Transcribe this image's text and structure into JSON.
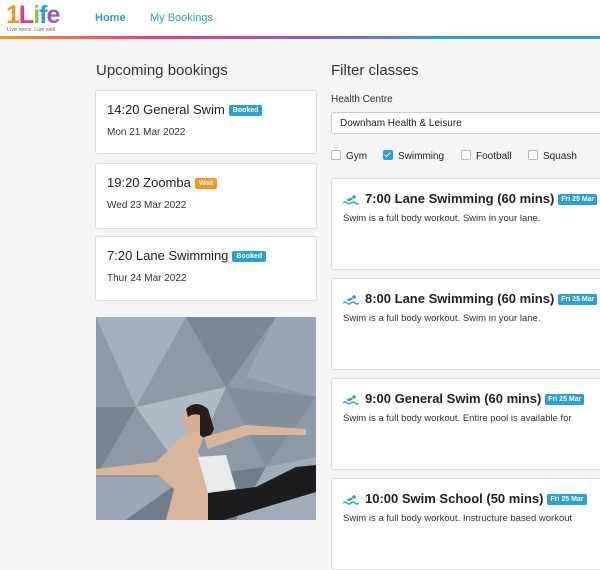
{
  "header": {
    "logo_main": "1Life",
    "logo_tagline": "Live more. Live well.",
    "nav": [
      {
        "label": "Home",
        "active": true
      },
      {
        "label": "My Bookings",
        "active": false
      }
    ]
  },
  "upcoming": {
    "heading": "Upcoming bookings",
    "bookings": [
      {
        "title": "14:20 General Swim",
        "badge": "Booked",
        "badge_color": "#2a9fd8",
        "date": "Mon 21 Mar 2022"
      },
      {
        "title": "19:20 Zoomba",
        "badge": "Wait",
        "badge_color": "#f7941d",
        "date": "Wed 23 Mar 2022"
      },
      {
        "title": "7:20 Lane Swimming",
        "badge": "Booked",
        "badge_color": "#2a9fd8",
        "date": "Thur 24 Mar 2022"
      }
    ]
  },
  "filter": {
    "heading": "Filter classes",
    "health_centre_label": "Health Centre",
    "health_centre_value": "Downham Health & Leisure",
    "activities": [
      {
        "label": "Gym",
        "checked": false
      },
      {
        "label": "Swimming",
        "checked": true
      },
      {
        "label": "Football",
        "checked": false
      },
      {
        "label": "Squash",
        "checked": false
      }
    ]
  },
  "classes": [
    {
      "icon": "swimmer-icon",
      "title": "7:00 Lane Swimming (60 mins)",
      "date_badge": "Fri 25 Mar",
      "description": "Swim is a full body workout. Swim in your lane."
    },
    {
      "icon": "swimmer-icon",
      "title": "8:00 Lane Swimming (60 mins)",
      "date_badge": "Fri 25 Mar",
      "description": "Swim is a full body workout. Swim in your lane."
    },
    {
      "icon": "swimmer-icon",
      "title": "9:00 General Swim (60 mins)",
      "date_badge": "Fri 25 Mar",
      "description": "Swim is a full body workout. Entire pool is available for"
    },
    {
      "icon": "swimmer-icon",
      "title": "10:00 Swim School (50 mins)",
      "date_badge": "Fri 25 Mar",
      "description": "Swim is a full body workout. Instructure based workout"
    }
  ],
  "colors": {
    "accent": "#2a9fd8",
    "wait": "#f7941d"
  }
}
